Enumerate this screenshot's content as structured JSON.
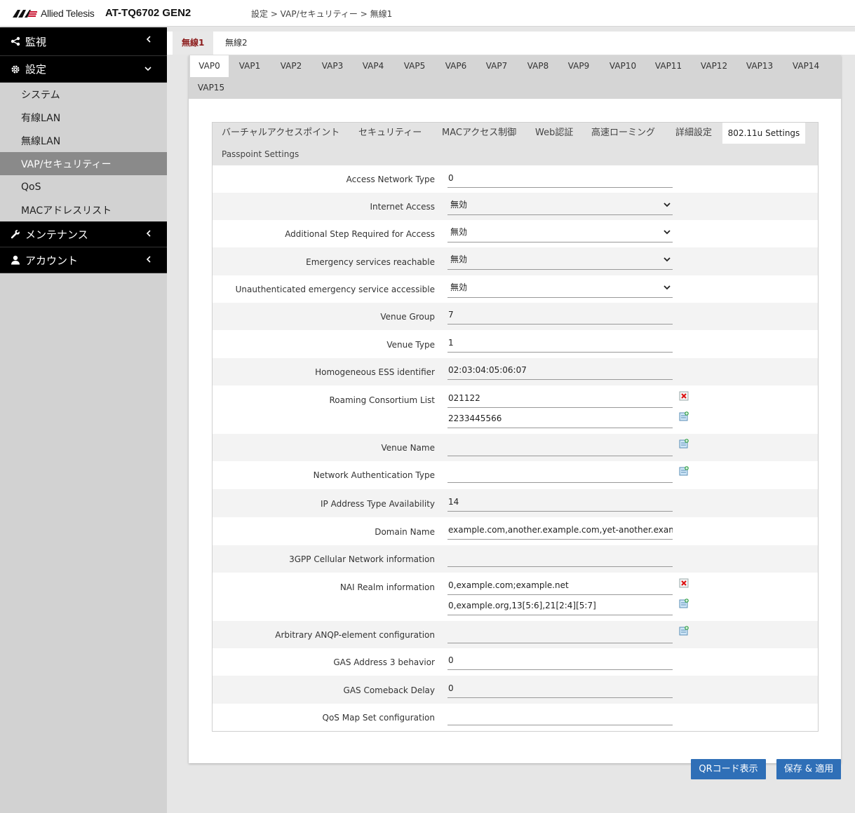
{
  "header": {
    "brand": "Allied Telesis",
    "model": "AT-TQ6702 GEN2",
    "breadcrumb": "設定 > VAP/セキュリティー > 無線1"
  },
  "sidebar": {
    "sections": [
      {
        "label": "監視",
        "icon": "share-icon"
      },
      {
        "label": "設定",
        "icon": "gear-icon"
      }
    ],
    "settings_items": [
      "システム",
      "有線LAN",
      "無線LAN",
      "VAP/セキュリティー",
      "QoS",
      "MACアドレスリスト"
    ],
    "active_item": "VAP/セキュリティー",
    "maintenance": "メンテナンス",
    "account": "アカウント"
  },
  "radio_tabs": [
    "無線1",
    "無線2"
  ],
  "vap_tabs": [
    "VAP0",
    "VAP1",
    "VAP2",
    "VAP3",
    "VAP4",
    "VAP5",
    "VAP6",
    "VAP7",
    "VAP8",
    "VAP9",
    "VAP10",
    "VAP11",
    "VAP12",
    "VAP13",
    "VAP14",
    "VAP15"
  ],
  "sub_tabs": [
    "バーチャルアクセスポイント",
    "セキュリティー",
    "MACアクセス制御",
    "Web認証",
    "高速ローミング",
    "詳細設定",
    "802.11u Settings",
    "Passpoint Settings"
  ],
  "form": {
    "access_network_type": {
      "label": "Access Network Type",
      "value": "0"
    },
    "internet_access": {
      "label": "Internet Access",
      "value": "無効"
    },
    "additional_step": {
      "label": "Additional Step Required for Access",
      "value": "無効"
    },
    "emergency_reachable": {
      "label": "Emergency services reachable",
      "value": "無効"
    },
    "unauth_emergency": {
      "label": "Unauthenticated emergency service accessible",
      "value": "無効"
    },
    "venue_group": {
      "label": "Venue Group",
      "value": "7"
    },
    "venue_type": {
      "label": "Venue Type",
      "value": "1"
    },
    "hessid": {
      "label": "Homogeneous ESS identifier",
      "value": "02:03:04:05:06:07"
    },
    "roaming_consortium": {
      "label": "Roaming Consortium List",
      "values": [
        "021122",
        "2233445566"
      ]
    },
    "venue_name": {
      "label": "Venue Name",
      "value": ""
    },
    "network_auth_type": {
      "label": "Network Authentication Type",
      "value": ""
    },
    "ip_address_type": {
      "label": "IP Address Type Availability",
      "value": "14"
    },
    "domain_name": {
      "label": "Domain Name",
      "value": "example.com,another.example.com,yet-another.example"
    },
    "cellular_info": {
      "label": "3GPP Cellular Network information",
      "value": ""
    },
    "nai_realm": {
      "label": "NAI Realm information",
      "values": [
        "0,example.com;example.net",
        "0,example.org,13[5:6],21[2:4][5:7]"
      ]
    },
    "anqp_config": {
      "label": "Arbitrary ANQP-element configuration",
      "value": ""
    },
    "gas_address3": {
      "label": "GAS Address 3 behavior",
      "value": "0"
    },
    "gas_comeback": {
      "label": "GAS Comeback Delay",
      "value": "0"
    },
    "qos_map": {
      "label": "QoS Map Set configuration",
      "value": ""
    }
  },
  "buttons": {
    "qr": "QRコード表示",
    "save": "保存 & 適用"
  },
  "colors": {
    "accent": "#2f6fb7",
    "active_radio_tab": "#8b1a1a",
    "sidebar_header": "#000000"
  }
}
